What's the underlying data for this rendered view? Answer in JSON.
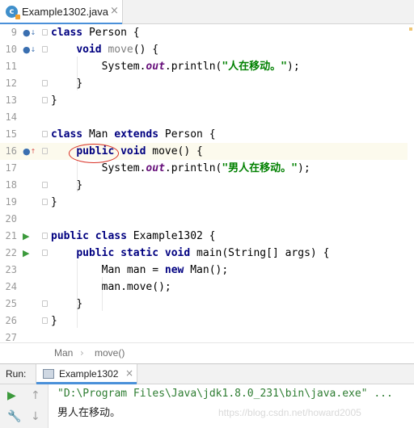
{
  "tab": {
    "title": "Example1302.java",
    "close": "×",
    "icon_letter": "c"
  },
  "lines": [
    {
      "num": "9"
    },
    {
      "num": "10"
    },
    {
      "num": "11"
    },
    {
      "num": "12"
    },
    {
      "num": "13"
    },
    {
      "num": "14"
    },
    {
      "num": "15"
    },
    {
      "num": "16"
    },
    {
      "num": "17"
    },
    {
      "num": "18"
    },
    {
      "num": "19"
    },
    {
      "num": "20"
    },
    {
      "num": "21"
    },
    {
      "num": "22"
    },
    {
      "num": "23"
    },
    {
      "num": "24"
    },
    {
      "num": "25"
    },
    {
      "num": "26"
    },
    {
      "num": "27"
    }
  ],
  "code": {
    "l9": {
      "kw": "class",
      "rest": " Person {"
    },
    "l10": {
      "kw": "void",
      "name": " move",
      "rest": "() {"
    },
    "l11": {
      "a": "System.",
      "out": "out",
      "b": ".println(",
      "str": "\"人在移动。\"",
      "c": ");"
    },
    "l12": {
      "rest": "}"
    },
    "l13": {
      "rest": "}"
    },
    "l15": {
      "kw1": "class",
      "a": " Man ",
      "kw2": "extends",
      "b": " Person {"
    },
    "l16": {
      "kw1": "public",
      "kw2": " void",
      "rest": " move() {"
    },
    "l17": {
      "a": "System.",
      "out": "out",
      "b": ".println(",
      "str": "\"男人在移动。\"",
      "c": ");"
    },
    "l18": {
      "rest": "}"
    },
    "l19": {
      "rest": "}"
    },
    "l21": {
      "kw1": "public",
      "kw2": " class",
      "rest": " Example1302 {"
    },
    "l22": {
      "kw": "public static void",
      "rest": " main(String[] args) {"
    },
    "l23": {
      "a": "Man man = ",
      "kw": "new",
      "b": " Man();"
    },
    "l24": {
      "rest": "man.move();"
    },
    "l25": {
      "rest": "}"
    },
    "l26": {
      "rest": "}"
    }
  },
  "breadcrumb": {
    "class": "Man",
    "method": "move()"
  },
  "run": {
    "label": "Run:",
    "tab": "Example1302",
    "close": "×"
  },
  "console": {
    "line1": "\"D:\\Program Files\\Java\\jdk1.8.0_231\\bin\\java.exe\" ...",
    "line2": "男人在移动。",
    "watermark": "https://blog.csdn.net/howard2005"
  },
  "colors": {
    "keyword": "#000080",
    "string": "#008000",
    "field": "#660e7a",
    "accent": "#4a90d9",
    "run_green": "#3c9a3c",
    "highlight": "#fcfaed"
  }
}
